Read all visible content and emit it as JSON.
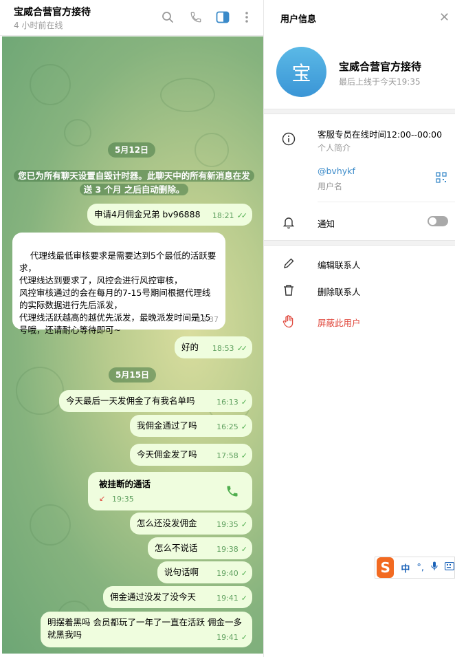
{
  "chat": {
    "title": "宝威合营官方接待",
    "status": "4 小时前在线",
    "icons": [
      "search-icon",
      "phone-icon",
      "sidebar-toggle-icon",
      "more-icon"
    ]
  },
  "messages": {
    "date1": "5月12日",
    "service": "您已为所有聊天设置自毁计时器。此聊天中的所有新消息在发送 3 个月 之后自动删除。",
    "m1": {
      "text": "申请4月佣金兄弟  bv96888",
      "time": "18:21"
    },
    "m2": {
      "text": "代理线最低审核要求是需要达到5个最低的活跃要求，\n代理线达到要求了，风控会进行风控审核，\n风控审核通过的会在每月的7-15号期间根据代理线的实际数据进行先后派发，\n代理线活跃越高的越优先派发，最晚派发时间是15号哦，还请耐心等待即可~",
      "time": "18:37"
    },
    "m3": {
      "text": "好的",
      "time": "18:53"
    },
    "date2": "5月15日",
    "m4": {
      "text": "今天最后一天发佣金了有我名单吗",
      "time": "16:13"
    },
    "m5": {
      "text": "我佣金通过了吗",
      "time": "16:25"
    },
    "m6": {
      "text": "今天佣金发了吗",
      "time": "17:58"
    },
    "call": {
      "title": "被挂断的通话",
      "time": "19:35"
    },
    "m7": {
      "text": "怎么还没发佣金",
      "time": "19:35"
    },
    "m8": {
      "text": "怎么不说话",
      "time": "19:38"
    },
    "m9": {
      "text": "说句话啊",
      "time": "19:40"
    },
    "m10": {
      "text": "佣金通过没发了没今天",
      "time": "19:41"
    },
    "m11": {
      "text": "明摆着黑吗 会员都玩了一年了一直在活跃 佣金一多就黑我吗",
      "time": "19:41"
    }
  },
  "info": {
    "title": "用户信息",
    "avatar_letter": "宝",
    "name": "宝威合营官方接待",
    "last_seen": "最后上线于今天19:35",
    "bio": "客服专员在线时间12:00--00:00",
    "bio_label": "个人简介",
    "username": "@bvhykf",
    "username_label": "用户名",
    "notify_label": "通知",
    "notify_on": false,
    "edit_contact": "编辑联系人",
    "delete_contact": "删除联系人",
    "block_user": "屏蔽此用户"
  },
  "ime": {
    "logo": "S",
    "lang": "中",
    "punct": "°,"
  },
  "colors": {
    "outgoing": "#effdde",
    "incoming": "#ffffff",
    "accent": "#3a8ac9",
    "danger": "#e0493e"
  }
}
